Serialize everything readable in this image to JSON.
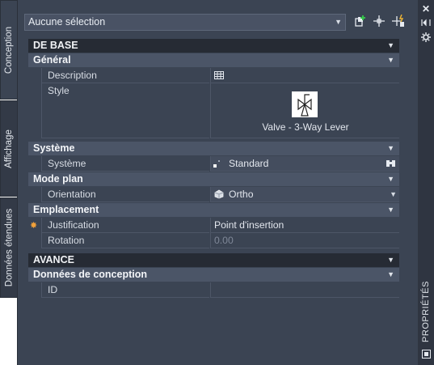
{
  "tabs": [
    {
      "label": "Conception"
    },
    {
      "label": "Affichage"
    },
    {
      "label": "Données étendues"
    }
  ],
  "selection": {
    "value": "Aucune sélection"
  },
  "right_strip": {
    "label": "PROPRIÉTÉS"
  },
  "sections": {
    "base": {
      "title": "DE BASE",
      "general": {
        "title": "Général",
        "description_label": "Description",
        "style_label": "Style",
        "style_value": "Valve - 3-Way Lever"
      },
      "systeme": {
        "title": "Système",
        "systeme_label": "Système",
        "systeme_value": "Standard"
      },
      "mode_plan": {
        "title": "Mode plan",
        "orientation_label": "Orientation",
        "orientation_value": "Ortho"
      },
      "emplacement": {
        "title": "Emplacement",
        "justification_label": "Justification",
        "justification_value": "Point d'insertion",
        "rotation_label": "Rotation",
        "rotation_value": "0.00"
      }
    },
    "avance": {
      "title": "AVANCE",
      "donnees": {
        "title": "Données de conception",
        "id_label": "ID",
        "id_value": ""
      }
    }
  }
}
